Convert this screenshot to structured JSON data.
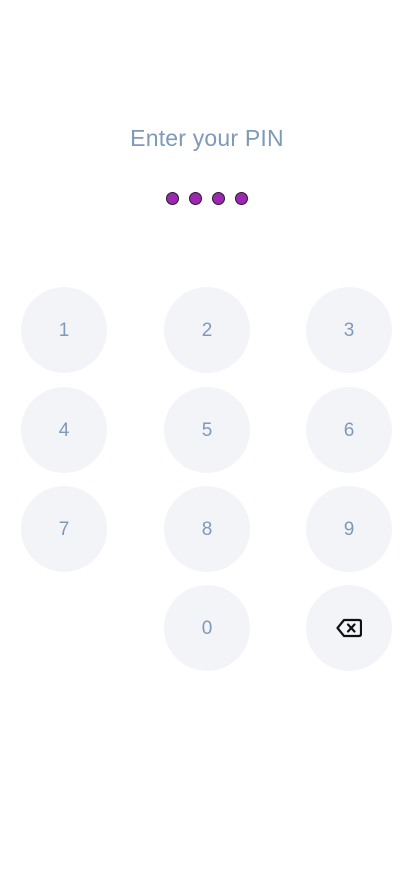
{
  "title": "Enter your PIN",
  "pin": {
    "entered": 4,
    "length": 4,
    "dot_color": "#9c27b0"
  },
  "keypad": {
    "keys": [
      "1",
      "2",
      "3",
      "4",
      "5",
      "6",
      "7",
      "8",
      "9",
      "0"
    ],
    "backspace_icon": "backspace-icon"
  },
  "colors": {
    "text": "#7f99b9",
    "key_background": "#f3f4f8",
    "background": "#ffffff"
  }
}
